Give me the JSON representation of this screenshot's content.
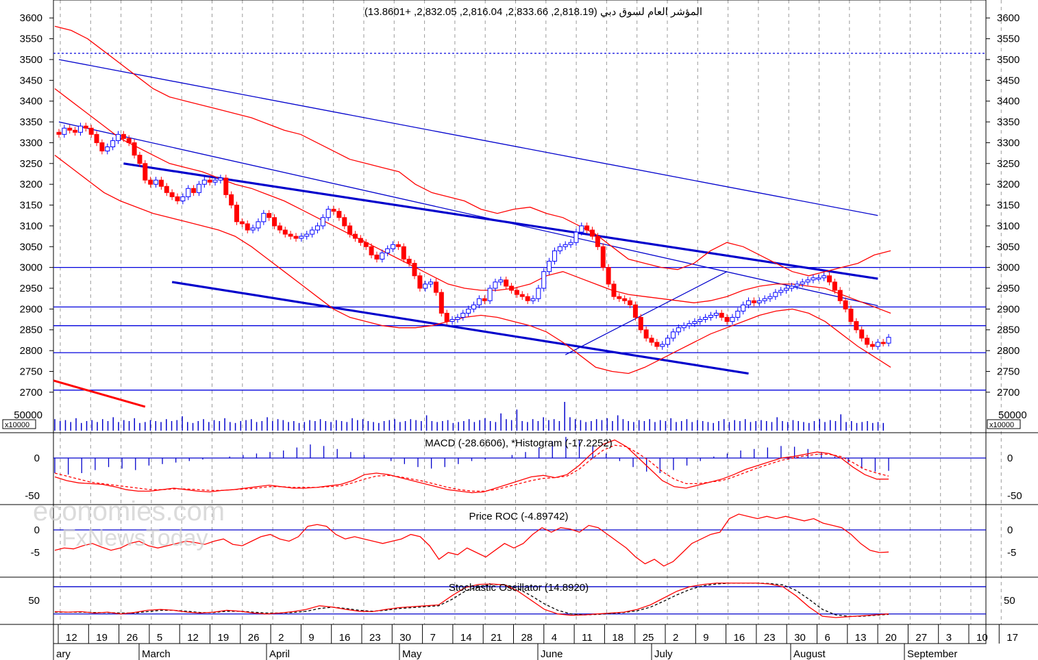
{
  "chart_data": {
    "type": "candlestick",
    "main_title": "المؤشر العام لسوق دبي (2,818.19, 2,833.66, 2,816.04, 2,832.05, +13.8601)",
    "panes": {
      "price": {
        "ylim": [
          2680,
          3630
        ],
        "ticks": [
          2700,
          2750,
          2800,
          2850,
          2900,
          2950,
          3000,
          3050,
          3100,
          3150,
          3200,
          3250,
          3300,
          3350,
          3400,
          3450,
          3500,
          3550,
          3600
        ],
        "horizontal_levels": [
          2705,
          2795,
          2860,
          2905,
          3000
        ],
        "dotted_level": 3515,
        "upper_channel_line": {
          "start": [
            0,
            3500
          ],
          "end": [
            152,
            3125
          ]
        },
        "mid_channel_line": {
          "start": [
            0,
            3350
          ],
          "end": [
            152,
            2908
          ]
        },
        "resistance_line": {
          "start": [
            12,
            3250
          ],
          "end": [
            152,
            2973
          ]
        },
        "support_line": {
          "start": [
            21,
            2965
          ],
          "end": [
            128,
            2745
          ]
        },
        "rising_trend_line": {
          "start": [
            94,
            2790
          ],
          "end": [
            124,
            2990
          ]
        },
        "red_line": {
          "start": [
            0,
            2728
          ],
          "end": [
            16,
            2665
          ]
        }
      },
      "volume": {
        "unit_label": "x10000",
        "tick": "50000",
        "ymax": 70000
      },
      "macd": {
        "title": "MACD (-28.6606), *Histogram (-17.2252)",
        "ylim": [
          -60,
          30
        ],
        "ticks": [
          "0",
          "-50"
        ]
      },
      "roc": {
        "title": "Price ROC (-4.89742)",
        "ylim": [
          -10,
          5
        ],
        "ticks": [
          "0",
          "-5"
        ]
      },
      "stochastic": {
        "title": "Stochastic Oscillator (14.8920)",
        "ylim": [
          0,
          95
        ],
        "ticks": [
          "50"
        ],
        "levels": [
          20,
          80
        ]
      }
    },
    "x_day_labels": [
      "12",
      "19",
      "26",
      "5",
      "12",
      "19",
      "26",
      "2",
      "9",
      "16",
      "23",
      "30",
      "7",
      "14",
      "21",
      "28",
      "4",
      "11",
      "18",
      "25",
      "2",
      "9",
      "16",
      "23",
      "30",
      "6",
      "13",
      "20",
      "27",
      "3",
      "10",
      "17"
    ],
    "x_month_labels": [
      "ary",
      "March",
      "April",
      "May",
      "June",
      "July",
      "August",
      "September"
    ],
    "closes": [
      3320,
      3335,
      3330,
      3325,
      3340,
      3335,
      3320,
      3300,
      3280,
      3290,
      3305,
      3320,
      3310,
      3300,
      3270,
      3250,
      3210,
      3200,
      3210,
      3195,
      3180,
      3170,
      3160,
      3170,
      3190,
      3180,
      3200,
      3210,
      3205,
      3210,
      3215,
      3175,
      3150,
      3110,
      3105,
      3090,
      3095,
      3110,
      3130,
      3120,
      3100,
      3090,
      3080,
      3075,
      3070,
      3075,
      3080,
      3090,
      3100,
      3120,
      3140,
      3135,
      3120,
      3100,
      3080,
      3070,
      3060,
      3050,
      3030,
      3020,
      3035,
      3045,
      3055,
      3050,
      3020,
      3010,
      2980,
      2950,
      2960,
      2965,
      2940,
      2890,
      2870,
      2875,
      2880,
      2890,
      2900,
      2910,
      2925,
      2920,
      2950,
      2965,
      2970,
      2955,
      2945,
      2935,
      2930,
      2920,
      2925,
      2950,
      2990,
      3015,
      3040,
      3050,
      3055,
      3060,
      3085,
      3100,
      3090,
      3075,
      3050,
      3000,
      2960,
      2930,
      2925,
      2920,
      2910,
      2880,
      2850,
      2830,
      2820,
      2810,
      2815,
      2830,
      2845,
      2855,
      2860,
      2865,
      2870,
      2875,
      2880,
      2885,
      2890,
      2880,
      2870,
      2880,
      2895,
      2910,
      2920,
      2915,
      2920,
      2925,
      2930,
      2940,
      2945,
      2950,
      2955,
      2960,
      2965,
      2970,
      2975,
      2975,
      2980,
      2965,
      2945,
      2920,
      2900,
      2870,
      2850,
      2830,
      2815,
      2810,
      2820,
      2818,
      2832
    ],
    "bollinger": {
      "upper": [
        3580,
        3570,
        3550,
        3520,
        3490,
        3460,
        3430,
        3410,
        3400,
        3390,
        3380,
        3370,
        3360,
        3345,
        3330,
        3320,
        3300,
        3280,
        3260,
        3250,
        3240,
        3230,
        3200,
        3180,
        3170,
        3160,
        3140,
        3130,
        3140,
        3145,
        3130,
        3120,
        3100,
        3080,
        3050,
        3020,
        3010,
        3000,
        2995,
        3010,
        3040,
        3060,
        3050,
        3030,
        3010,
        2990,
        2980,
        2990,
        3000,
        3010,
        3030,
        3040
      ],
      "mid": [
        3430,
        3400,
        3370,
        3340,
        3310,
        3290,
        3270,
        3250,
        3240,
        3230,
        3215,
        3200,
        3190,
        3175,
        3160,
        3140,
        3120,
        3100,
        3080,
        3060,
        3040,
        3020,
        3000,
        2980,
        2960,
        2950,
        2945,
        2945,
        2950,
        2960,
        2980,
        2990,
        2975,
        2960,
        2945,
        2935,
        2930,
        2925,
        2920,
        2915,
        2920,
        2930,
        2945,
        2955,
        2960,
        2960,
        2955,
        2950,
        2935,
        2920,
        2905,
        2890
      ],
      "lower": [
        3270,
        3240,
        3210,
        3180,
        3160,
        3145,
        3130,
        3120,
        3110,
        3100,
        3090,
        3075,
        3050,
        3020,
        2990,
        2960,
        2930,
        2900,
        2880,
        2870,
        2860,
        2855,
        2855,
        2860,
        2870,
        2880,
        2885,
        2880,
        2870,
        2860,
        2845,
        2820,
        2790,
        2760,
        2750,
        2745,
        2760,
        2780,
        2800,
        2820,
        2840,
        2855,
        2870,
        2885,
        2895,
        2900,
        2890,
        2870,
        2840,
        2810,
        2785,
        2760
      ]
    },
    "volume_values": [
      12,
      10,
      11,
      9,
      13,
      8,
      10,
      11,
      9,
      12,
      10,
      14,
      9,
      11,
      10,
      13,
      8,
      9,
      11,
      10,
      9,
      12,
      10,
      11,
      15,
      9,
      8,
      10,
      12,
      9,
      11,
      10,
      13,
      9,
      8,
      10,
      11,
      12,
      9,
      10,
      14,
      10,
      12,
      11,
      9,
      10,
      8,
      9,
      11,
      10,
      12,
      10,
      9,
      11,
      10,
      9,
      13,
      11,
      12,
      10,
      9,
      8,
      10,
      11,
      12,
      9,
      10,
      12,
      11,
      10,
      16,
      10,
      9,
      10,
      11,
      8,
      9,
      10,
      12,
      9,
      11,
      13,
      10,
      9,
      18,
      12,
      11,
      22,
      10,
      9,
      12,
      10,
      14,
      11,
      12,
      10,
      30,
      14,
      12,
      11,
      9,
      10,
      12,
      11,
      13,
      10,
      16,
      12,
      10,
      9,
      11,
      10,
      12,
      9,
      11,
      10,
      13,
      9,
      10,
      12,
      9,
      11,
      10,
      9,
      8,
      10,
      12,
      9,
      11,
      10,
      12,
      9,
      10,
      11,
      10,
      9,
      14,
      10,
      9,
      11,
      10,
      9,
      8,
      10,
      12,
      9,
      11,
      10,
      17,
      9,
      10,
      8,
      9,
      10,
      8,
      9,
      8
    ],
    "macd_line": [
      -25,
      -30,
      -33,
      -34,
      -35,
      -38,
      -42,
      -44,
      -44,
      -42,
      -40,
      -42,
      -44,
      -45,
      -43,
      -42,
      -40,
      -38,
      -36,
      -38,
      -40,
      -40,
      -39,
      -37,
      -35,
      -30,
      -22,
      -20,
      -22,
      -26,
      -30,
      -34,
      -38,
      -42,
      -44,
      -46,
      -45,
      -40,
      -35,
      -30,
      -25,
      -23,
      -26,
      -22,
      -10,
      5,
      18,
      24,
      15,
      0,
      -15,
      -30,
      -38,
      -40,
      -36,
      -32,
      -28,
      -22,
      -15,
      -10,
      -5,
      0,
      2,
      5,
      8,
      6,
      0,
      -12,
      -22,
      -28,
      -28
    ],
    "macd_signal": [
      -20,
      -24,
      -28,
      -32,
      -34,
      -36,
      -38,
      -40,
      -42,
      -42,
      -41,
      -41,
      -42,
      -43,
      -43,
      -42,
      -41,
      -40,
      -38,
      -38,
      -39,
      -39,
      -39,
      -38,
      -37,
      -33,
      -28,
      -24,
      -23,
      -25,
      -28,
      -31,
      -35,
      -39,
      -42,
      -44,
      -44,
      -42,
      -38,
      -34,
      -30,
      -27,
      -26,
      -24,
      -15,
      -2,
      10,
      17,
      15,
      6,
      -5,
      -18,
      -28,
      -34,
      -34,
      -32,
      -30,
      -25,
      -19,
      -13,
      -8,
      -3,
      0,
      3,
      5,
      5,
      2,
      -6,
      -15,
      -20,
      -24
    ],
    "macd_hist": [
      -20,
      -22,
      -20,
      -16,
      -12,
      -14,
      -16,
      -10,
      -8,
      -6,
      -4,
      -2,
      0,
      2,
      4,
      6,
      8,
      10,
      14,
      18,
      16,
      12,
      8,
      4,
      0,
      -4,
      -8,
      -12,
      -14,
      -12,
      -8,
      -4,
      -2,
      0,
      4,
      8,
      14,
      22,
      28,
      24,
      16,
      6,
      -4,
      -12,
      -18,
      -20,
      -16,
      -10,
      -4,
      2,
      6,
      10,
      12,
      14,
      16,
      15,
      12,
      8,
      2,
      -6,
      -14,
      -18,
      -17
    ],
    "roc_values": [
      -4.5,
      -4.0,
      -4.2,
      -3.5,
      -3.0,
      -3.8,
      -4.5,
      -4.0,
      -3.0,
      -2.5,
      -3.5,
      -4.0,
      -3.5,
      -3.0,
      -2.5,
      -2.8,
      -3.2,
      -2.5,
      -2.0,
      -3.2,
      -3.5,
      -2.5,
      -1.5,
      -1.0,
      -2.0,
      -2.5,
      -1.5,
      0.8,
      1.2,
      0.8,
      -1.0,
      -2.0,
      -1.5,
      -2.0,
      -2.5,
      -3.0,
      -2.5,
      -2.0,
      -1.0,
      -1.5,
      -3.5,
      -6.5,
      -5.0,
      -5.5,
      -4.0,
      -5.0,
      -6.0,
      -4.5,
      -3.0,
      -4.0,
      -3.0,
      -1.0,
      0.5,
      -0.5,
      0.5,
      0.2,
      -0.5,
      1.0,
      0.5,
      -1.0,
      -2.5,
      -4.0,
      -6.0,
      -7.5,
      -6.5,
      -8.0,
      -7.0,
      -5.0,
      -3.0,
      -2.0,
      -1.0,
      -0.5,
      2.5,
      3.5,
      3.0,
      2.5,
      3.0,
      2.5,
      3.0,
      2.5,
      2.0,
      2.5,
      1.5,
      1.0,
      0.5,
      -1.0,
      -3.0,
      -4.5,
      -5.0,
      -4.9
    ],
    "stoch_k": [
      25,
      24,
      25,
      22,
      24,
      20,
      23,
      28,
      30,
      28,
      24,
      22,
      24,
      28,
      26,
      22,
      20,
      22,
      25,
      30,
      38,
      35,
      30,
      26,
      25,
      30,
      34,
      36,
      38,
      40,
      60,
      78,
      85,
      86,
      84,
      70,
      50,
      30,
      20,
      17,
      18,
      20,
      22,
      24,
      30,
      40,
      55,
      70,
      80,
      85,
      88,
      88,
      88,
      88,
      86,
      80,
      60,
      35,
      15,
      12,
      14,
      16,
      18,
      20
    ],
    "stoch_d": [
      24,
      24,
      24,
      23,
      23,
      22,
      22,
      25,
      28,
      28,
      26,
      23,
      23,
      26,
      26,
      24,
      22,
      22,
      23,
      26,
      32,
      35,
      32,
      28,
      26,
      28,
      32,
      34,
      36,
      38,
      52,
      70,
      80,
      85,
      84,
      76,
      60,
      42,
      28,
      20,
      18,
      19,
      21,
      23,
      27,
      35,
      48,
      62,
      74,
      82,
      86,
      88,
      88,
      88,
      87,
      84,
      72,
      52,
      30,
      18,
      15,
      15,
      17,
      19
    ]
  }
}
